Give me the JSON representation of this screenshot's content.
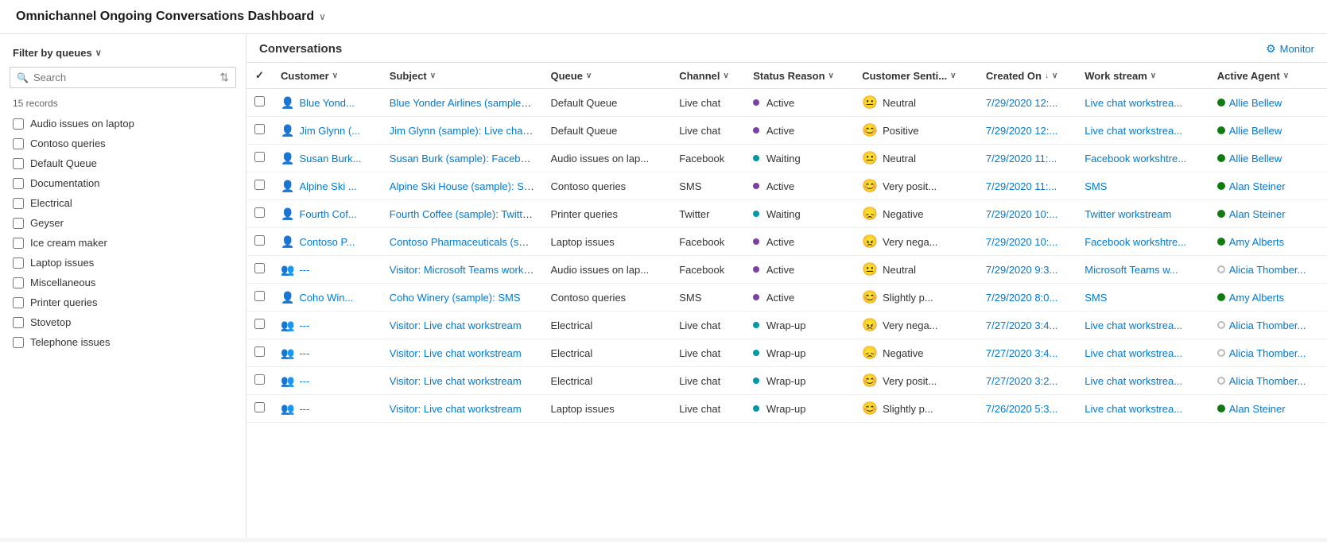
{
  "header": {
    "title": "Omnichannel Ongoing Conversations Dashboard",
    "chevron": "∨"
  },
  "sidebar": {
    "filter_label": "Filter by queues",
    "filter_chevron": "∨",
    "search_placeholder": "Search",
    "records_count": "15 records",
    "queues": [
      {
        "label": "Audio issues on laptop"
      },
      {
        "label": "Contoso queries"
      },
      {
        "label": "Default Queue"
      },
      {
        "label": "Documentation"
      },
      {
        "label": "Electrical"
      },
      {
        "label": "Geyser"
      },
      {
        "label": "Ice cream maker"
      },
      {
        "label": "Laptop issues"
      },
      {
        "label": "Miscellaneous"
      },
      {
        "label": "Printer queries"
      },
      {
        "label": "Stovetop"
      },
      {
        "label": "Telephone issues"
      }
    ]
  },
  "conversations": {
    "title": "Conversations",
    "monitor_label": "Monitor",
    "columns": [
      {
        "id": "customer",
        "label": "Customer",
        "sortable": true
      },
      {
        "id": "subject",
        "label": "Subject",
        "sortable": true
      },
      {
        "id": "queue",
        "label": "Queue",
        "sortable": true
      },
      {
        "id": "channel",
        "label": "Channel",
        "sortable": true
      },
      {
        "id": "status",
        "label": "Status Reason",
        "sortable": true
      },
      {
        "id": "sentiment",
        "label": "Customer Senti...",
        "sortable": true
      },
      {
        "id": "created",
        "label": "Created On",
        "sortable": true,
        "sorted": "desc"
      },
      {
        "id": "workstream",
        "label": "Work stream",
        "sortable": true
      },
      {
        "id": "agent",
        "label": "Active Agent",
        "sortable": true
      }
    ],
    "rows": [
      {
        "customer_icon": "person",
        "customer": "Blue Yond...",
        "subject": "Blue Yonder Airlines (sample): Live c...",
        "queue": "Default Queue",
        "channel": "Live chat",
        "status_color": "purple",
        "status": "Active",
        "sentiment_emoji": "😐",
        "sentiment": "Neutral",
        "created": "7/29/2020 12:...",
        "workstream": "Live chat workstrea...",
        "agent_status": "green",
        "agent": "Allie Bellew"
      },
      {
        "customer_icon": "person",
        "customer": "Jim Glynn (...",
        "subject": "Jim Glynn (sample): Live chat works...",
        "queue": "Default Queue",
        "channel": "Live chat",
        "status_color": "purple",
        "status": "Active",
        "sentiment_emoji": "😊",
        "sentiment": "Positive",
        "created": "7/29/2020 12:...",
        "workstream": "Live chat workstrea...",
        "agent_status": "green",
        "agent": "Allie Bellew"
      },
      {
        "customer_icon": "person",
        "customer": "Susan Burk...",
        "subject": "Susan Burk (sample): Facebook wor...",
        "queue": "Audio issues on lap...",
        "channel": "Facebook",
        "status_color": "teal",
        "status": "Waiting",
        "sentiment_emoji": "😐",
        "sentiment": "Neutral",
        "created": "7/29/2020 11:...",
        "workstream": "Facebook workshtre...",
        "agent_status": "green",
        "agent": "Allie Bellew"
      },
      {
        "customer_icon": "person",
        "customer": "Alpine Ski ...",
        "subject": "Alpine Ski House (sample): SMS",
        "queue": "Contoso queries",
        "channel": "SMS",
        "status_color": "purple",
        "status": "Active",
        "sentiment_emoji": "😊",
        "sentiment": "Very posit...",
        "created": "7/29/2020 11:...",
        "workstream": "SMS",
        "agent_status": "green",
        "agent": "Alan Steiner"
      },
      {
        "customer_icon": "person",
        "customer": "Fourth Cof...",
        "subject": "Fourth Coffee (sample): Twitter wor...",
        "queue": "Printer queries",
        "channel": "Twitter",
        "status_color": "teal",
        "status": "Waiting",
        "sentiment_emoji": "😞",
        "sentiment": "Negative",
        "created": "7/29/2020 10:...",
        "workstream": "Twitter workstream",
        "agent_status": "green",
        "agent": "Alan Steiner"
      },
      {
        "customer_icon": "person",
        "customer": "Contoso P...",
        "subject": "Contoso Pharmaceuticals (sample):...",
        "queue": "Laptop issues",
        "channel": "Facebook",
        "status_color": "purple",
        "status": "Active",
        "sentiment_emoji": "😠",
        "sentiment": "Very nega...",
        "created": "7/29/2020 10:...",
        "workstream": "Facebook workshtre...",
        "agent_status": "green",
        "agent": "Amy Alberts"
      },
      {
        "customer_icon": "visitor",
        "customer": "---",
        "subject": "Visitor: Microsoft Teams workstream",
        "queue": "Audio issues on lap...",
        "channel": "Facebook",
        "status_color": "purple",
        "status": "Active",
        "sentiment_emoji": "😐",
        "sentiment": "Neutral",
        "created": "7/29/2020 9:3...",
        "workstream": "Microsoft Teams w...",
        "agent_status": "outline",
        "agent": "Alicia Thomber..."
      },
      {
        "customer_icon": "person",
        "customer": "Coho Win...",
        "subject": "Coho Winery (sample): SMS",
        "queue": "Contoso queries",
        "channel": "SMS",
        "status_color": "purple",
        "status": "Active",
        "sentiment_emoji": "😊",
        "sentiment": "Slightly p...",
        "created": "7/29/2020 8:0...",
        "workstream": "SMS",
        "agent_status": "green",
        "agent": "Amy Alberts"
      },
      {
        "customer_icon": "visitor",
        "customer": "---",
        "subject": "Visitor: Live chat workstream",
        "queue": "Electrical",
        "channel": "Live chat",
        "status_color": "teal",
        "status": "Wrap-up",
        "sentiment_emoji": "😠",
        "sentiment": "Very nega...",
        "created": "7/27/2020 3:4...",
        "workstream": "Live chat workstrea...",
        "agent_status": "outline",
        "agent": "Alicia Thomber..."
      },
      {
        "customer_icon": "visitor",
        "customer": "---",
        "subject": "Visitor: Live chat workstream",
        "queue": "Electrical",
        "channel": "Live chat",
        "status_color": "teal",
        "status": "Wrap-up",
        "sentiment_emoji": "😞",
        "sentiment": "Negative",
        "created": "7/27/2020 3:4...",
        "workstream": "Live chat workstrea...",
        "agent_status": "outline",
        "agent": "Alicia Thomber..."
      },
      {
        "customer_icon": "visitor",
        "customer": "---",
        "subject": "Visitor: Live chat workstream",
        "queue": "Electrical",
        "channel": "Live chat",
        "status_color": "teal",
        "status": "Wrap-up",
        "sentiment_emoji": "😊",
        "sentiment": "Very posit...",
        "created": "7/27/2020 3:2...",
        "workstream": "Live chat workstrea...",
        "agent_status": "outline",
        "agent": "Alicia Thomber..."
      },
      {
        "customer_icon": "visitor",
        "customer": "---",
        "subject": "Visitor: Live chat workstream",
        "queue": "Laptop issues",
        "channel": "Live chat",
        "status_color": "teal",
        "status": "Wrap-up",
        "sentiment_emoji": "😊",
        "sentiment": "Slightly p...",
        "created": "7/26/2020 5:3...",
        "workstream": "Live chat workstrea...",
        "agent_status": "green",
        "agent": "Alan Steiner"
      }
    ]
  }
}
